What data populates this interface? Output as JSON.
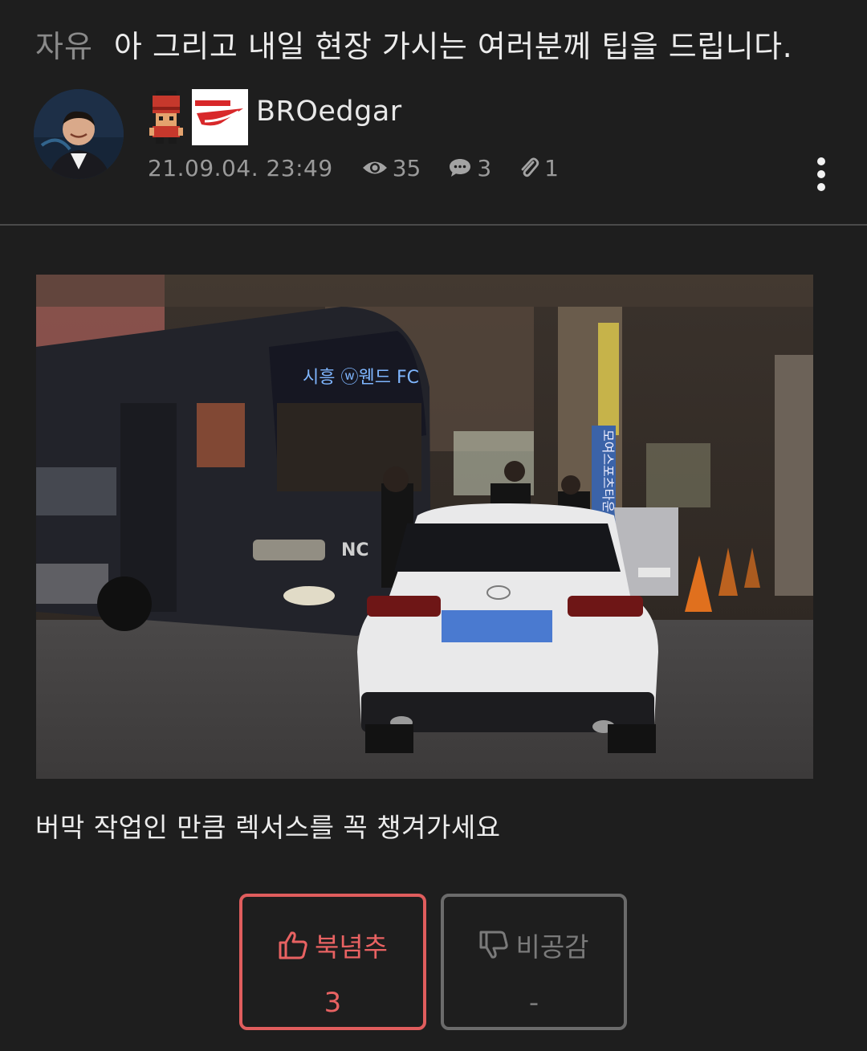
{
  "post": {
    "category": "자유",
    "title": "아 그리고 내일 현장 가시는 여러분께 팁을 드립니다.",
    "author": "BROedgar",
    "date": "21.09.04. 23:49",
    "views": "35",
    "comments": "3",
    "attachments": "1",
    "body_text": "버막 작업인 만큼 렉서스를 꼭 챙겨가세요"
  },
  "photo": {
    "bus_sign": "시흥 ⓦ웬드 FC",
    "banner_text": "모여스포츠타운"
  },
  "votes": {
    "up_label": "북념추",
    "up_count": "3",
    "down_label": "비공감",
    "down_count": "-"
  },
  "colors": {
    "background": "#1e1e1e",
    "upvote_accent": "#e05d5d",
    "downvote_border": "#6b6b6b",
    "muted_text": "#9a9a9a"
  },
  "icons": [
    "eye-icon",
    "comment-icon",
    "paperclip-icon",
    "more-vertical-icon",
    "thumbs-up-icon",
    "thumbs-down-icon"
  ]
}
